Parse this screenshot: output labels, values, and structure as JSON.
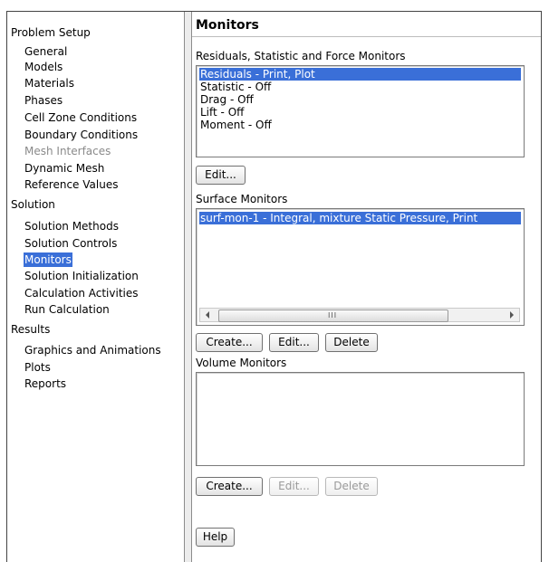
{
  "tree": {
    "categories": [
      {
        "label": "Problem Setup",
        "items": [
          {
            "label": "General",
            "state": "normal"
          },
          {
            "label": "Models",
            "state": "normal"
          },
          {
            "label": "Materials",
            "state": "normal"
          },
          {
            "label": "Phases",
            "state": "normal"
          },
          {
            "label": "Cell Zone Conditions",
            "state": "normal"
          },
          {
            "label": "Boundary Conditions",
            "state": "normal"
          },
          {
            "label": "Mesh Interfaces",
            "state": "disabled"
          },
          {
            "label": "Dynamic Mesh",
            "state": "normal"
          },
          {
            "label": "Reference Values",
            "state": "normal"
          }
        ]
      },
      {
        "label": "Solution",
        "items": [
          {
            "label": "Solution Methods",
            "state": "normal"
          },
          {
            "label": "Solution Controls",
            "state": "normal"
          },
          {
            "label": "Monitors",
            "state": "selected"
          },
          {
            "label": "Solution Initialization",
            "state": "normal"
          },
          {
            "label": "Calculation Activities",
            "state": "normal"
          },
          {
            "label": "Run Calculation",
            "state": "normal"
          }
        ]
      },
      {
        "label": "Results",
        "items": [
          {
            "label": "Graphics and Animations",
            "state": "normal"
          },
          {
            "label": "Plots",
            "state": "normal"
          },
          {
            "label": "Reports",
            "state": "normal"
          }
        ]
      }
    ]
  },
  "panel": {
    "title": "Monitors",
    "residuals": {
      "label": "Residuals, Statistic and Force Monitors",
      "items": [
        {
          "label": "Residuals - Print, Plot",
          "selected": true
        },
        {
          "label": "Statistic - Off",
          "selected": false
        },
        {
          "label": "Drag - Off",
          "selected": false
        },
        {
          "label": "Lift - Off",
          "selected": false
        },
        {
          "label": "Moment - Off",
          "selected": false
        }
      ],
      "edit_label": "Edit..."
    },
    "surface": {
      "label": "Surface Monitors",
      "items": [
        {
          "label": "surf-mon-1 - Integral, mixture Static Pressure, Print",
          "selected": true
        }
      ],
      "scroll_grip": "III",
      "create_label": "Create...",
      "edit_label": "Edit...",
      "delete_label": "Delete"
    },
    "volume": {
      "label": "Volume Monitors",
      "items": [],
      "create_label": "Create...",
      "edit_label": "Edit...",
      "delete_label": "Delete",
      "edit_enabled": false,
      "delete_enabled": false
    },
    "help_label": "Help"
  },
  "colors": {
    "selection": "#3a6fd8",
    "disabled_text": "#8a8a8a"
  }
}
